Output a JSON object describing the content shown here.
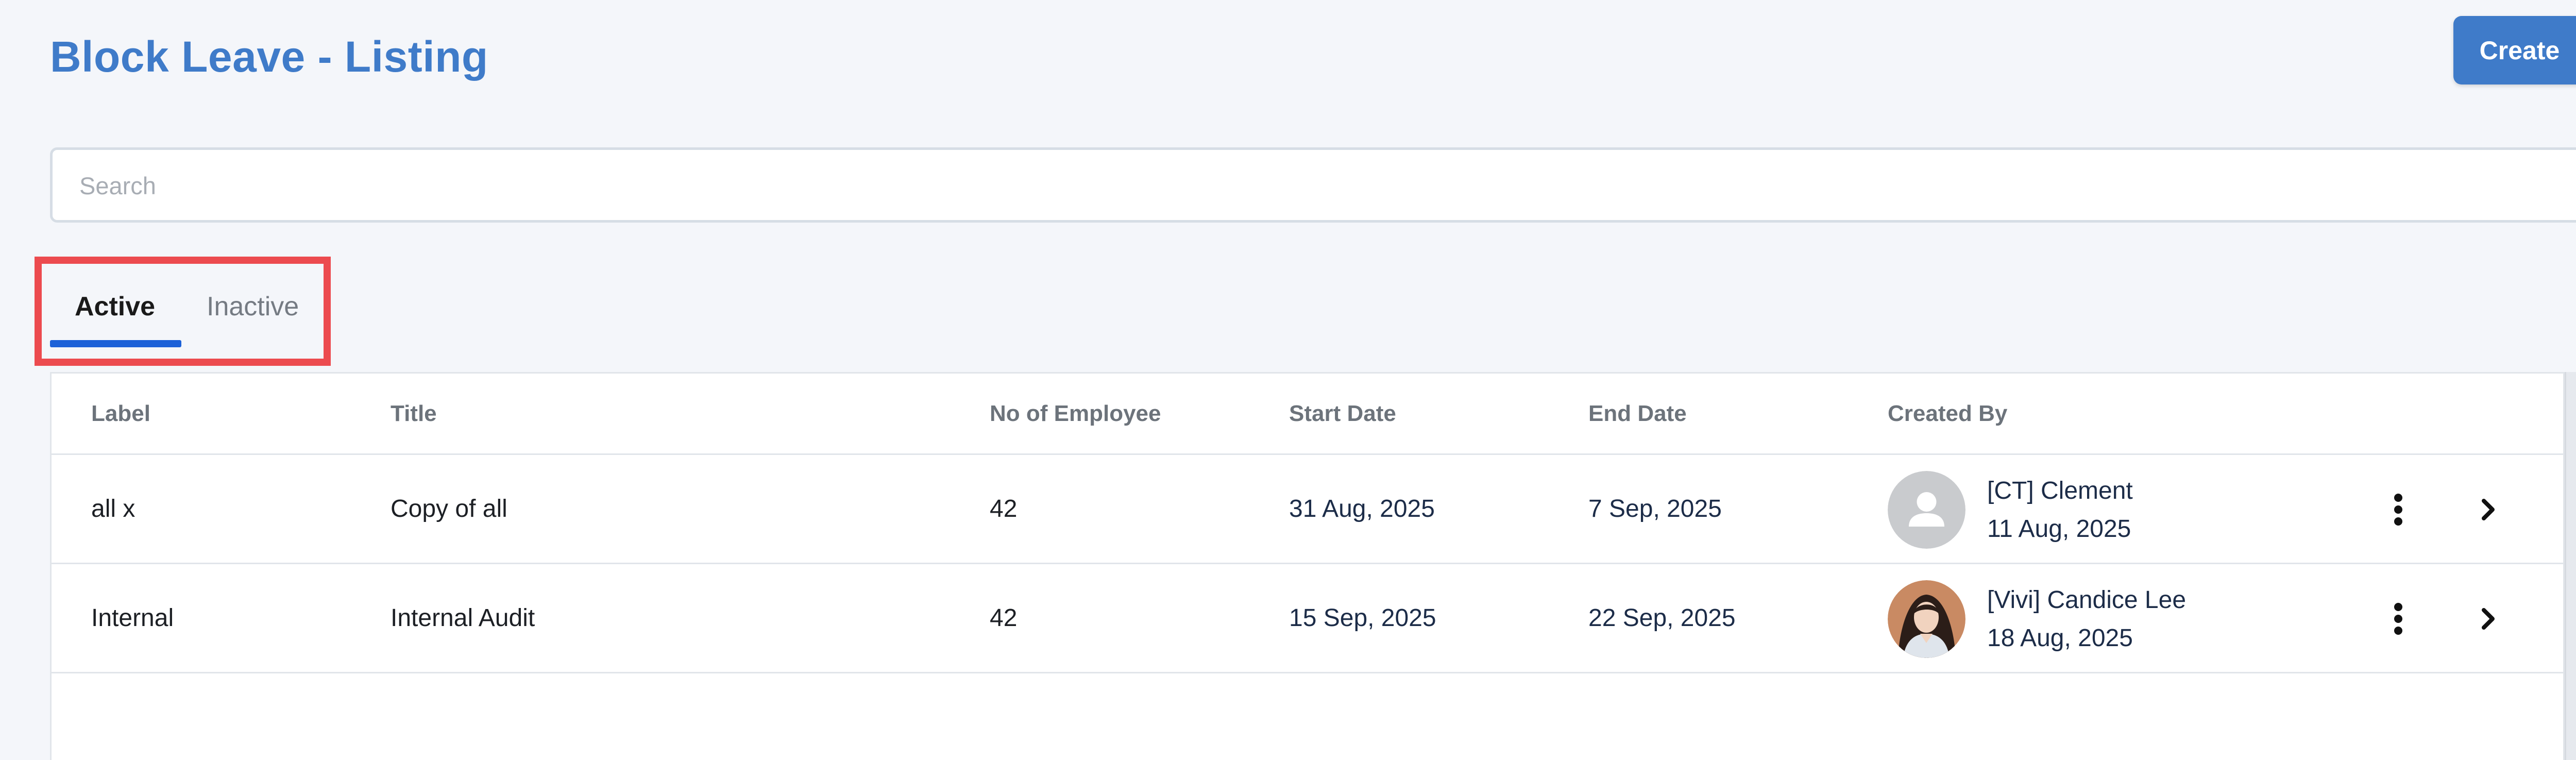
{
  "page": {
    "title": "Block Leave - Listing",
    "create_label": "Create"
  },
  "search": {
    "placeholder": "Search",
    "value": ""
  },
  "tabs": [
    {
      "label": "Active",
      "selected": true
    },
    {
      "label": "Inactive",
      "selected": false
    }
  ],
  "table": {
    "headers": [
      "Label",
      "Title",
      "No of Employee",
      "Start Date",
      "End Date",
      "Created By"
    ],
    "rows": [
      {
        "label": "all x",
        "title": "Copy of all",
        "employees": "42",
        "start_date": "31 Aug, 2025",
        "end_date": "7 Sep, 2025",
        "created_by_name": "[CT] Clement",
        "created_by_date": "11 Aug, 2025",
        "avatar": "default-user-avatar"
      },
      {
        "label": "Internal",
        "title": "Internal Audit",
        "employees": "42",
        "start_date": "15 Sep, 2025",
        "end_date": "22 Sep, 2025",
        "created_by_name": "[Vivi] Candice Lee",
        "created_by_date": "18 Aug, 2025",
        "avatar": "user-photo-avatar"
      }
    ]
  },
  "icons": {
    "row_menu": "kebab-menu-icon",
    "row_open": "chevron-right-icon"
  },
  "colors": {
    "accent": "#3f7bc9",
    "tab_underline": "#1c61d8",
    "highlight_box": "#ec4b4f",
    "background": "#f4f6fa"
  }
}
